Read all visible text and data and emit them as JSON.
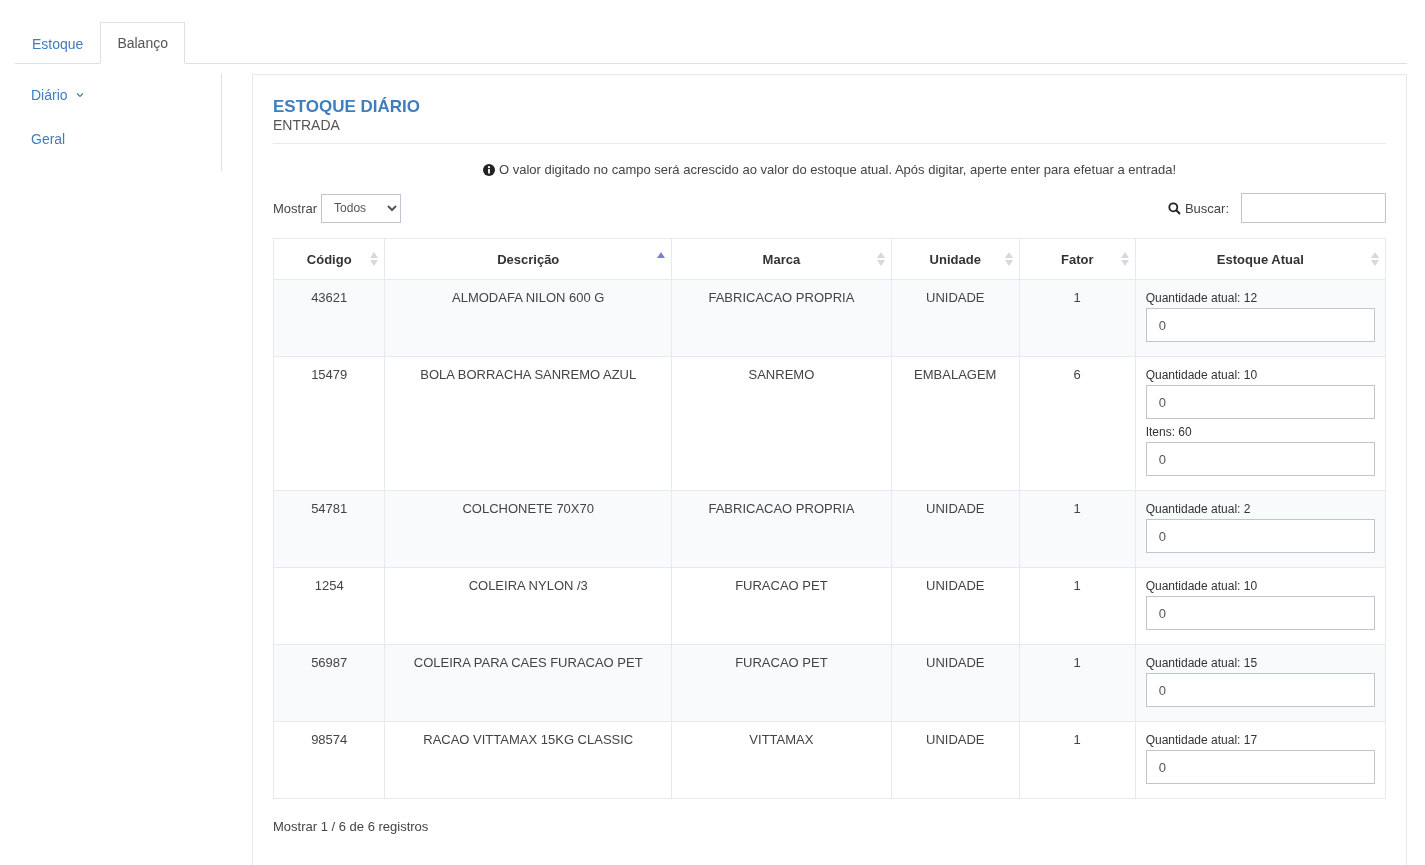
{
  "tabs": [
    {
      "label": "Estoque",
      "selected": false
    },
    {
      "label": "Balanço",
      "selected": true
    }
  ],
  "sidebar": {
    "items": [
      {
        "label": "Diário",
        "expandable": true
      },
      {
        "label": "Geral",
        "expandable": false
      }
    ]
  },
  "panel": {
    "title": "ESTOQUE DIÁRIO",
    "subtitle": "ENTRADA",
    "notice": "O valor digitado no campo será acrescido ao valor do estoque atual. Após digitar, aperte enter para efetuar a entrada!",
    "length_label": "Mostrar",
    "length_value": "Todos",
    "search_label": "Buscar:",
    "table": {
      "columns": [
        {
          "label": "Código",
          "sorted_ascending": false
        },
        {
          "label": "Descrição",
          "sorted_ascending": true
        },
        {
          "label": "Marca",
          "sorted_ascending": false
        },
        {
          "label": "Unidade",
          "sorted_ascending": false
        },
        {
          "label": "Fator",
          "sorted_ascending": false
        },
        {
          "label": "Estoque Atual",
          "sorted_ascending": false
        }
      ],
      "rows": [
        {
          "cells": [
            "43621",
            "ALMODAFA NILON 600 G",
            "FABRICACAO PROPRIA",
            "UNIDADE",
            "1"
          ],
          "fields": [
            {
              "label": "Quantidade atual: 12",
              "value": "0"
            }
          ]
        },
        {
          "cells": [
            "15479",
            "BOLA BORRACHA SANREMO AZUL",
            "SANREMO",
            "EMBALAGEM",
            "6"
          ],
          "fields": [
            {
              "label": "Quantidade atual: 10",
              "value": "0"
            },
            {
              "label": "Itens: 60",
              "value": "0"
            }
          ]
        },
        {
          "cells": [
            "54781",
            "COLCHONETE 70X70",
            "FABRICACAO PROPRIA",
            "UNIDADE",
            "1"
          ],
          "fields": [
            {
              "label": "Quantidade atual: 2",
              "value": "0"
            }
          ]
        },
        {
          "cells": [
            "1254",
            "COLEIRA NYLON /3",
            "FURACAO PET",
            "UNIDADE",
            "1"
          ],
          "fields": [
            {
              "label": "Quantidade atual: 10",
              "value": "0"
            }
          ]
        },
        {
          "cells": [
            "56987",
            "COLEIRA PARA CAES FURACAO PET",
            "FURACAO PET",
            "UNIDADE",
            "1"
          ],
          "fields": [
            {
              "label": "Quantidade atual: 15",
              "value": "0"
            }
          ]
        },
        {
          "cells": [
            "98574",
            "RACAO VITTAMAX 15KG CLASSIC",
            "VITTAMAX",
            "UNIDADE",
            "1"
          ],
          "fields": [
            {
              "label": "Quantidade atual: 17",
              "value": "0"
            }
          ]
        }
      ]
    },
    "footer": "Mostrar 1 / 6 de 6 registros"
  }
}
